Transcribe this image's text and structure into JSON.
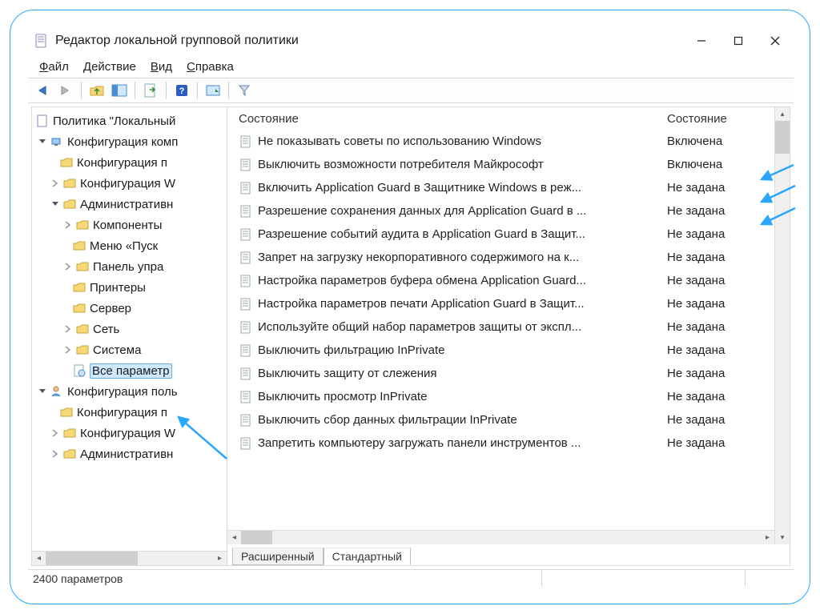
{
  "window": {
    "title": "Редактор локальной групповой политики"
  },
  "menu": {
    "file": "Файл",
    "action": "Действие",
    "view": "Вид",
    "help": "Справка"
  },
  "tree": {
    "root": "Политика \"Локальный",
    "computer_cfg": "Конфигурация комп",
    "software_cfg": "Конфигурация п",
    "windows_cfg": "Конфигурация W",
    "admin_templates": "Административн",
    "components": "Компоненты",
    "start_menu": "Меню «Пуск",
    "control_panel": "Панель упра",
    "printers": "Принтеры",
    "server": "Сервер",
    "network": "Сеть",
    "system": "Система",
    "all_settings": "Все параметр",
    "user_cfg": "Конфигурация поль",
    "u_software_cfg": "Конфигурация п",
    "u_windows_cfg": "Конфигурация W",
    "u_admin_templates": "Административн"
  },
  "list": {
    "col1": "Состояние",
    "col2": "Состояние",
    "rows": [
      {
        "name": "Не показывать советы по использованию Windows",
        "state": "Включена"
      },
      {
        "name": "Выключить возможности потребителя Майкрософт",
        "state": "Включена"
      },
      {
        "name": "Включить Application Guard в Защитнике Windows в реж...",
        "state": "Не задана"
      },
      {
        "name": "Разрешение сохранения данных для Application Guard в ...",
        "state": "Не задана"
      },
      {
        "name": "Разрешение событий аудита в Application Guard в Защит...",
        "state": "Не задана"
      },
      {
        "name": "Запрет на загрузку некорпоративного содержимого на к...",
        "state": "Не задана"
      },
      {
        "name": "Настройка параметров буфера обмена Application Guard...",
        "state": "Не задана"
      },
      {
        "name": "Настройка параметров печати Application Guard в Защит...",
        "state": "Не задана"
      },
      {
        "name": "Используйте общий набор параметров защиты от экспл...",
        "state": "Не задана"
      },
      {
        "name": "Выключить фильтрацию InPrivate",
        "state": "Не задана"
      },
      {
        "name": "Выключить защиту от слежения",
        "state": "Не задана"
      },
      {
        "name": "Выключить просмотр InPrivate",
        "state": "Не задана"
      },
      {
        "name": "Выключить сбор данных фильтрации InPrivate",
        "state": "Не задана"
      },
      {
        "name": "Запретить компьютеру загружать панели инструментов ...",
        "state": "Не задана"
      }
    ]
  },
  "tabs": {
    "extended": "Расширенный",
    "standard": "Стандартный"
  },
  "status": "2400 параметров"
}
